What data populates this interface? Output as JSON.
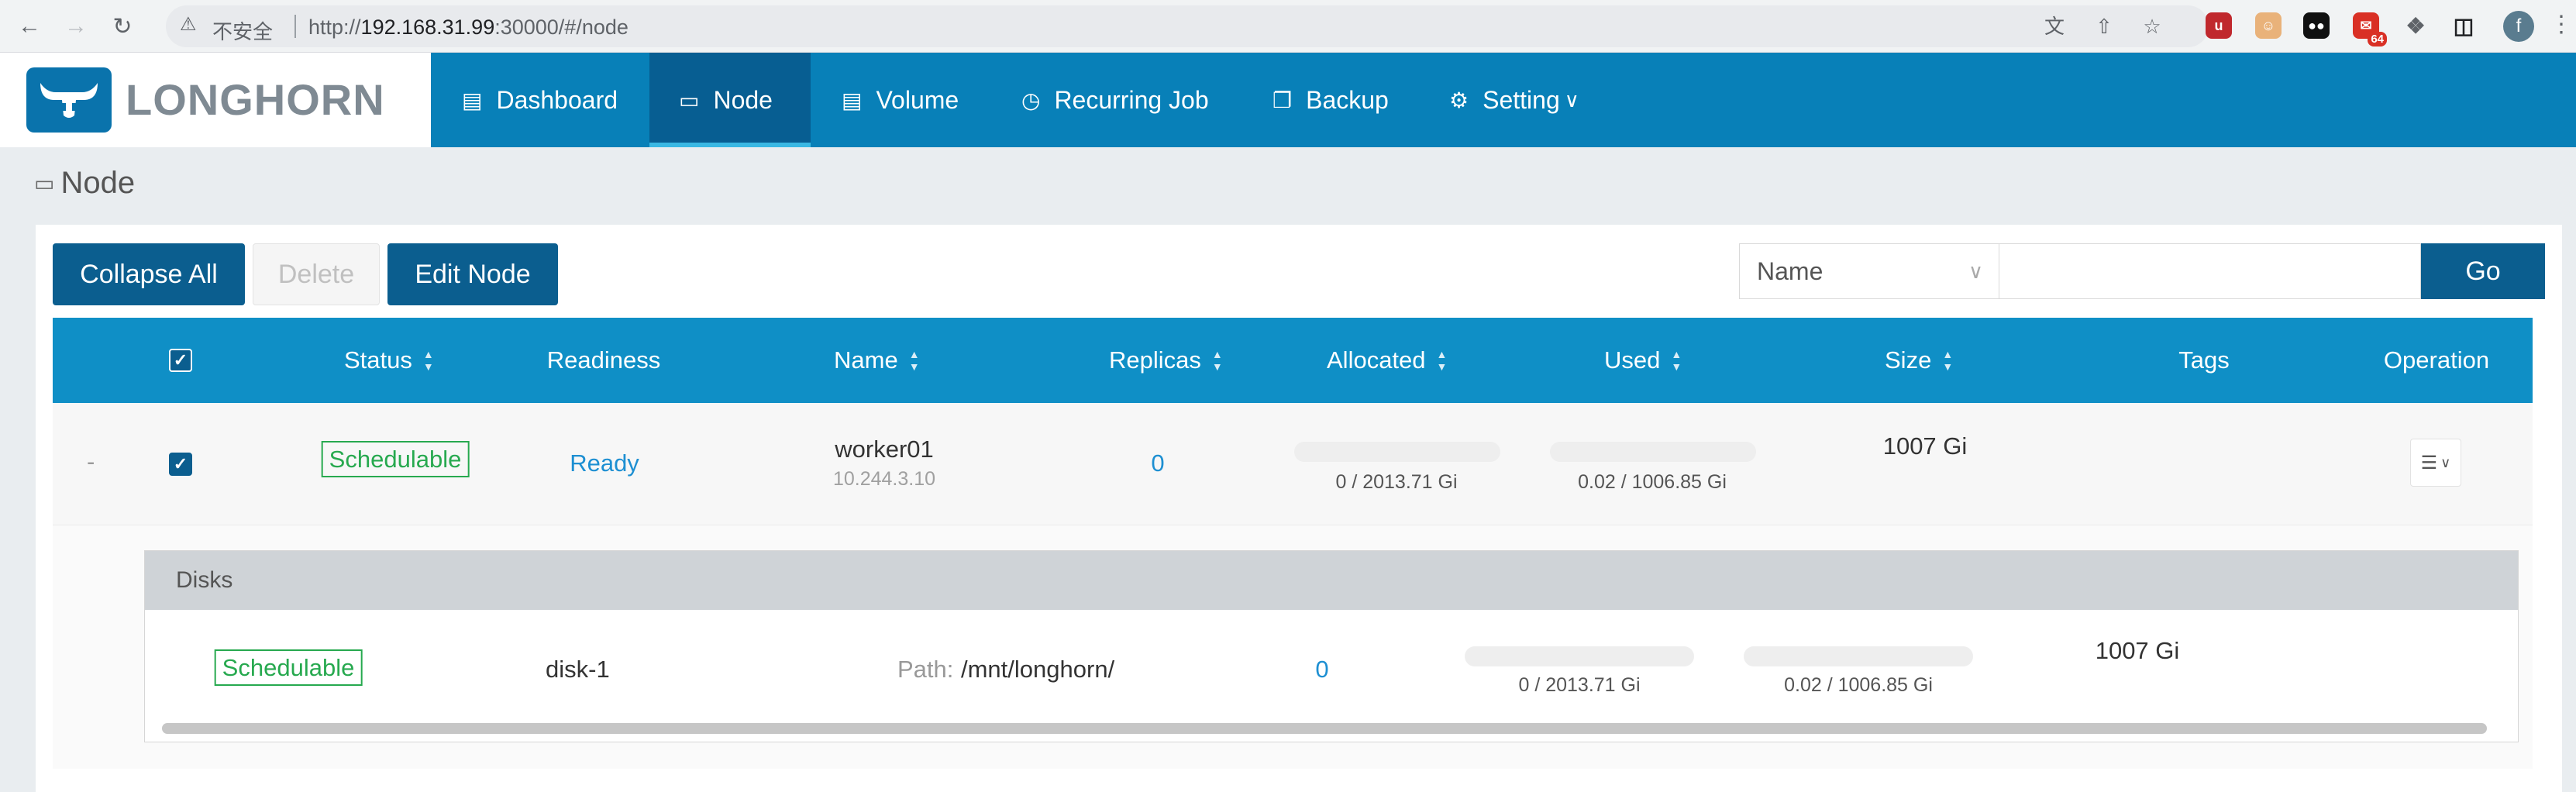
{
  "browser": {
    "insecure_label": "不安全",
    "url_prefix": "http://",
    "url_host": "192.168.31.99",
    "url_rest": ":30000/#/node",
    "ext_badge": "64",
    "profile_initial": "f"
  },
  "app": {
    "brand": "LONGHORN",
    "accent_color": "#0880b8",
    "menu": [
      {
        "label": "Dashboard",
        "icon": "bar-chart-icon"
      },
      {
        "label": "Node",
        "icon": "laptop-icon"
      },
      {
        "label": "Volume",
        "icon": "database-icon"
      },
      {
        "label": "Recurring Job",
        "icon": "clock-icon"
      },
      {
        "label": "Backup",
        "icon": "copy-icon"
      },
      {
        "label": "Setting",
        "icon": "gear-icon"
      }
    ],
    "active_menu": "Node"
  },
  "page": {
    "title": "Node"
  },
  "toolbar": {
    "collapse_all": "Collapse All",
    "delete": "Delete",
    "edit_node": "Edit Node",
    "search_field": "Name",
    "search_value": "",
    "go": "Go"
  },
  "table": {
    "columns": [
      "Status",
      "Readiness",
      "Name",
      "Replicas",
      "Allocated",
      "Used",
      "Size",
      "Tags",
      "Operation"
    ],
    "rows": [
      {
        "expand_toggle": "-",
        "checked": true,
        "status": "Schedulable",
        "readiness": "Ready",
        "name": "worker01",
        "ip": "10.244.3.10",
        "replicas": "0",
        "allocated": "0 / 2013.71 Gi",
        "allocated_fraction": 0,
        "used": "0.02 / 1006.85 Gi",
        "used_fraction": 2e-05,
        "size": "1007 Gi",
        "tags": ""
      }
    ]
  },
  "disks": {
    "header": "Disks",
    "rows": [
      {
        "status": "Schedulable",
        "name": "disk-1",
        "path_label": "Path:",
        "path": "/mnt/longhorn/",
        "replicas": "0",
        "allocated": "0 / 2013.71 Gi",
        "allocated_fraction": 0,
        "used": "0.02 / 1006.85 Gi",
        "used_fraction": 2e-05,
        "size": "1007 Gi"
      }
    ]
  }
}
